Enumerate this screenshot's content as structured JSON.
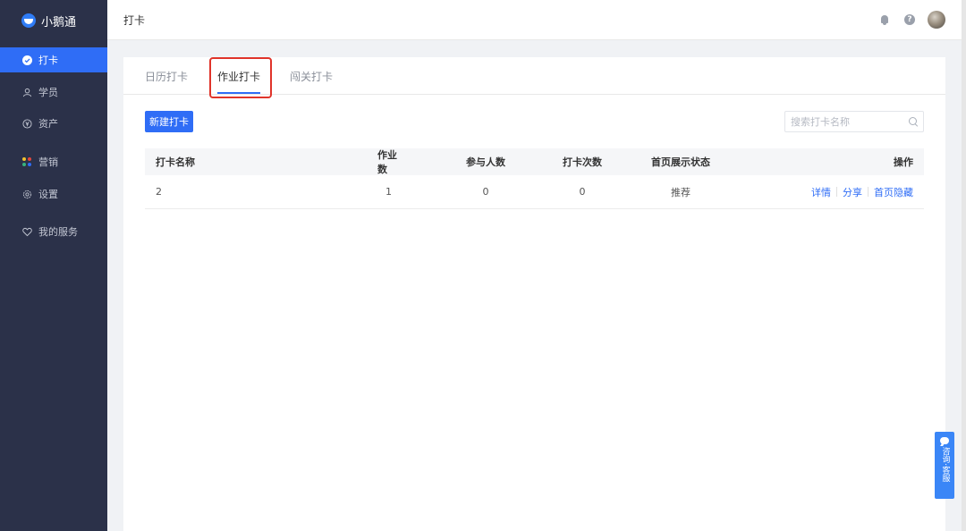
{
  "brand": {
    "name": "小鹅通"
  },
  "sidebar": {
    "items": [
      {
        "label": "打卡",
        "icon": "check-circle-icon",
        "active": true
      },
      {
        "label": "学员",
        "icon": "user-icon",
        "active": false
      },
      {
        "label": "资产",
        "icon": "yen-icon",
        "active": false
      },
      {
        "label": "营销",
        "icon": "dots-grid-icon",
        "active": false
      },
      {
        "label": "设置",
        "icon": "gear-icon",
        "active": false
      },
      {
        "label": "我的服务",
        "icon": "heart-icon",
        "active": false
      }
    ]
  },
  "header": {
    "title": "打卡"
  },
  "tabs": [
    {
      "label": "日历打卡",
      "active": false
    },
    {
      "label": "作业打卡",
      "active": true
    },
    {
      "label": "闯关打卡",
      "active": false
    }
  ],
  "toolbar": {
    "new_label": "新建打卡",
    "search_placeholder": "搜索打卡名称"
  },
  "table": {
    "headers": {
      "name": "打卡名称",
      "homework": "作业数",
      "participants": "参与人数",
      "checkins": "打卡次数",
      "status": "首页展示状态",
      "ops": "操作"
    },
    "rows": [
      {
        "name": "2",
        "homework": "1",
        "participants": "0",
        "checkins": "0",
        "status": "推荐",
        "ops": [
          "详情",
          "分享",
          "首页隐藏"
        ]
      }
    ]
  },
  "consult": {
    "label": "咨询·客服"
  },
  "colors": {
    "sidebar_bg": "#2b3149",
    "accent": "#2f6df6",
    "highlight_border": "#e0342a"
  }
}
